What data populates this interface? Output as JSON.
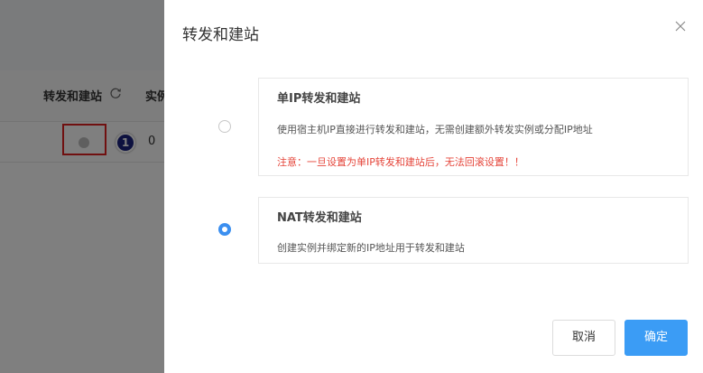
{
  "background": {
    "column_title": "转发和建站",
    "column_title_2": "实例",
    "cell_value": "0",
    "badge": "1"
  },
  "dialog": {
    "title": "转发和建站",
    "options": [
      {
        "title": "单IP转发和建站",
        "description": "使用宿主机IP直接进行转发和建站，无需创建额外转发实例或分配IP地址",
        "warning": "注意：一旦设置为单IP转发和建站后，无法回滚设置！！",
        "selected": false
      },
      {
        "title": "NAT转发和建站",
        "description": "创建实例并绑定新的IP地址用于转发和建站",
        "selected": true
      }
    ],
    "cancel_label": "取消",
    "ok_label": "确定"
  },
  "colors": {
    "accent": "#3b9cf5",
    "warning": "#e5453a",
    "highlight_border": "#e02020",
    "badge_bg": "#1a237e"
  }
}
